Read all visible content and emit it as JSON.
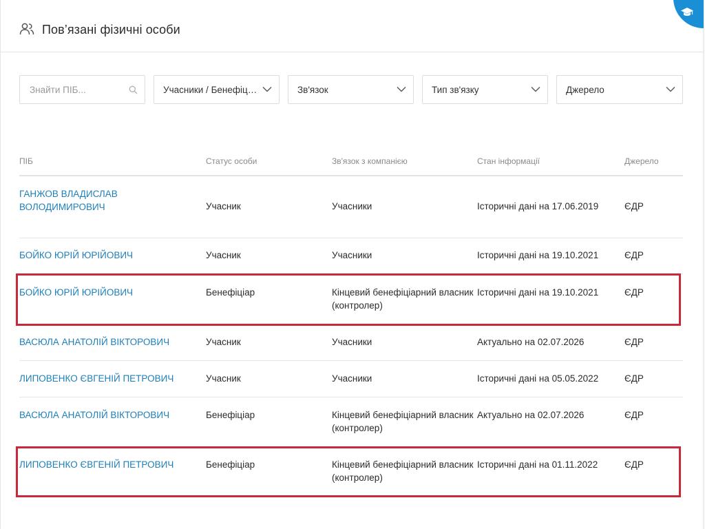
{
  "header": {
    "title": "Пов’язані фізичні особи",
    "icon": "people-icon",
    "corner_icon": "graduation-cap-icon",
    "corner_color": "#1a8fd6"
  },
  "filters": {
    "search_placeholder": "Знайти ПІБ...",
    "participants": "Учасники / Бенефіціа...",
    "relation": "Зв'язок",
    "relation_type": "Тип зв'язку",
    "source": "Джерело"
  },
  "table": {
    "columns": [
      "ПІБ",
      "Статус особи",
      "Зв'язок з компанією",
      "Стан інформації",
      "Джерело"
    ],
    "rows": [
      {
        "name": "ГАНЖОВ ВЛАДИСЛАВ ВОЛОДИМИРОВИЧ",
        "status": "Учасник",
        "relation": "Учасники",
        "info": "Історичні дані на 17.06.2019",
        "source": "ЄДР",
        "highlighted": false
      },
      {
        "name": "БОЙКО ЮРІЙ ЮРІЙОВИЧ",
        "status": "Учасник",
        "relation": "Учасники",
        "info": "Історичні дані на 19.10.2021",
        "source": "ЄДР",
        "highlighted": false
      },
      {
        "name": "БОЙКО ЮРІЙ ЮРІЙОВИЧ",
        "status": "Бенефіціар",
        "relation": "Кінцевий бенефіціарний власник (контролер)",
        "info": "Історичні дані на 19.10.2021",
        "source": "ЄДР",
        "highlighted": true
      },
      {
        "name": "ВАСЮЛА АНАТОЛІЙ ВІКТОРОВИЧ",
        "status": "Учасник",
        "relation": "Учасники",
        "info": "Актуально на 02.07.2026",
        "source": "ЄДР",
        "highlighted": false
      },
      {
        "name": "ЛИПОВЕНКО ЄВГЕНІЙ ПЕТРОВИЧ",
        "status": "Учасник",
        "relation": "Учасники",
        "info": "Історичні дані на 05.05.2022",
        "source": "ЄДР",
        "highlighted": false
      },
      {
        "name": "ВАСЮЛА АНАТОЛІЙ ВІКТОРОВИЧ",
        "status": "Бенефіціар",
        "relation": "Кінцевий бенефіціарний власник (контролер)",
        "info": "Актуально на 02.07.2026",
        "source": "ЄДР",
        "highlighted": false
      },
      {
        "name": "ЛИПОВЕНКО ЄВГЕНІЙ ПЕТРОВИЧ",
        "status": "Бенефіціар",
        "relation": "Кінцевий бенефіціарний власник (контролер)",
        "info": "Історичні дані на 01.11.2022",
        "source": "ЄДР",
        "highlighted": true
      }
    ]
  },
  "colors": {
    "link": "#1e7fb8",
    "highlight": "#c8283a"
  }
}
